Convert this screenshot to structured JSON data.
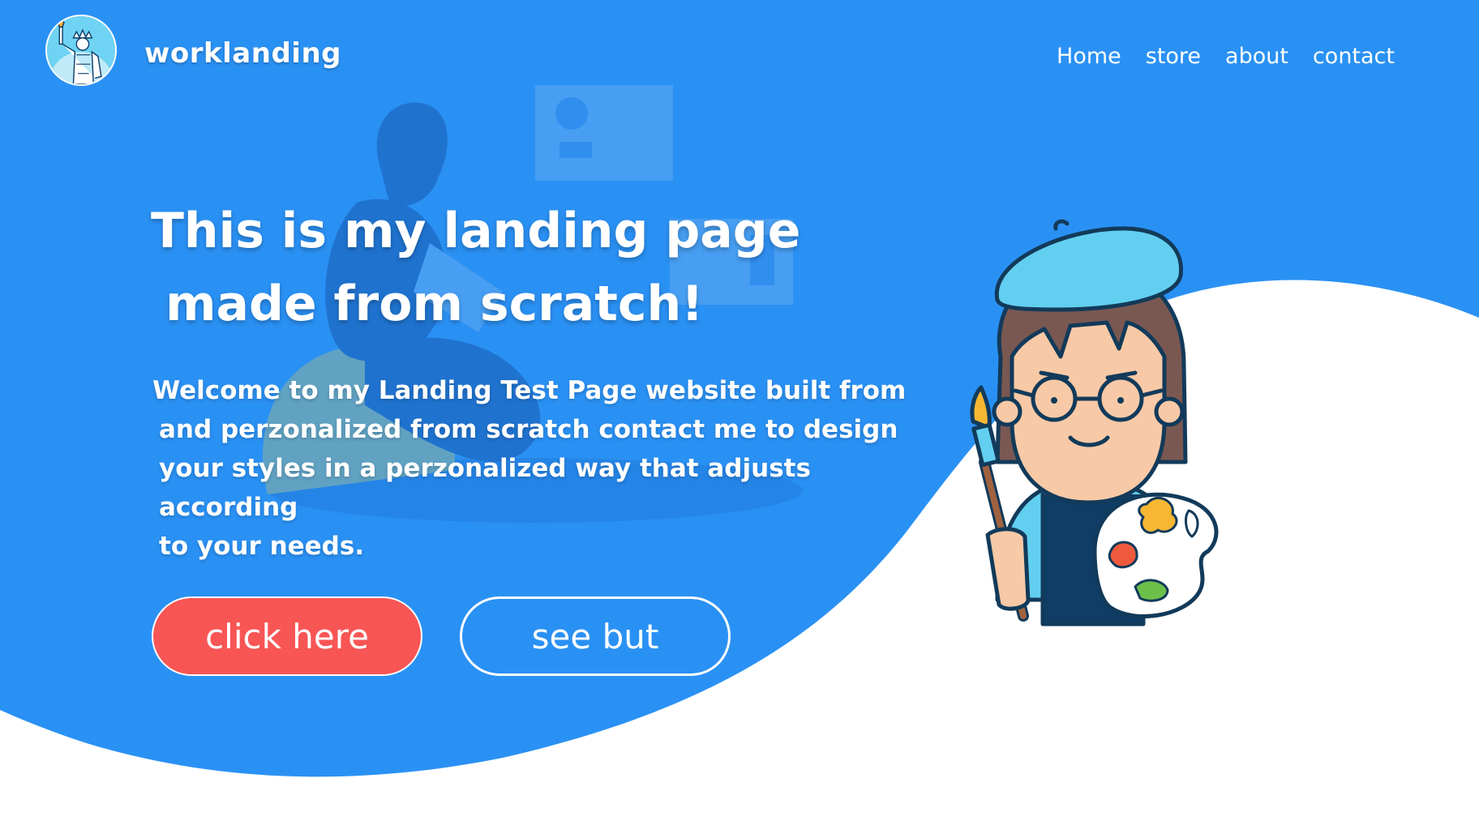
{
  "colors": {
    "background_blue": "#2a91f4",
    "button_primary": "#f85555",
    "text": "#ffffff",
    "logo_bg": "#6fd3f3"
  },
  "brand": {
    "name": "worklanding",
    "logo_icon": "statue-of-liberty-icon"
  },
  "nav": {
    "items": [
      "Home",
      "store",
      "about",
      "contact"
    ]
  },
  "hero": {
    "title_line1": "This is my landing page",
    "title_line2": "made from scratch!",
    "text_lines": [
      "Welcome to my Landing Test Page website built from",
      "and perzonalized from scratch contact me to design",
      "your styles in a perzonalized way that adjusts according",
      "to your needs."
    ]
  },
  "buttons": {
    "primary": "click here",
    "secondary": "see but"
  },
  "illustrations": {
    "background": "woman-reading-illustration",
    "artist": "painter-girl-with-palette-illustration"
  }
}
